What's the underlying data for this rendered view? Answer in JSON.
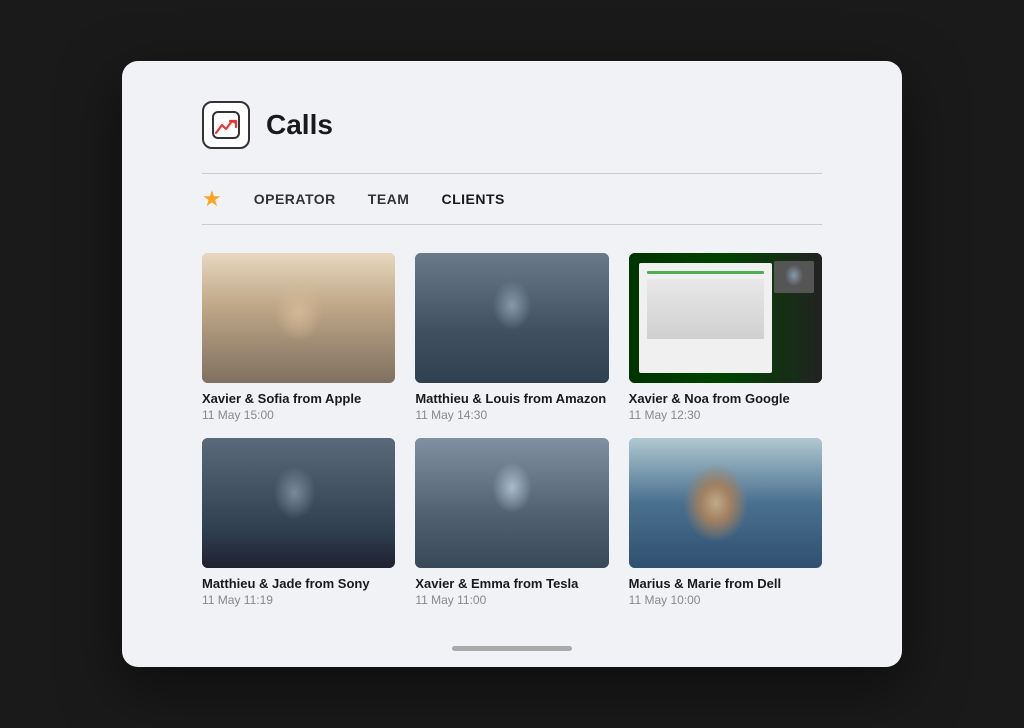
{
  "app": {
    "icon": "📉",
    "title": "Calls"
  },
  "tabs": [
    {
      "id": "operator",
      "label": "OPERATOR",
      "active": false
    },
    {
      "id": "team",
      "label": "TEAM",
      "active": false
    },
    {
      "id": "clients",
      "label": "CLIENTS",
      "active": true
    }
  ],
  "calls": [
    {
      "id": 1,
      "name": "Xavier & Sofia from Apple",
      "date": "11 May 15:00",
      "thumb": "thumb-1"
    },
    {
      "id": 2,
      "name": "Matthieu & Louis from Amazon",
      "date": "11 May 14:30",
      "thumb": "thumb-2"
    },
    {
      "id": 3,
      "name": "Xavier & Noa from Google",
      "date": "11 May 12:30",
      "thumb": "thumb-3"
    },
    {
      "id": 4,
      "name": "Matthieu & Jade from Sony",
      "date": "11 May 11:19",
      "thumb": "thumb-4"
    },
    {
      "id": 5,
      "name": "Xavier & Emma from Tesla",
      "date": "11 May 11:00",
      "thumb": "thumb-5"
    },
    {
      "id": 6,
      "name": "Marius & Marie from Dell",
      "date": "11 May 10:00",
      "thumb": "thumb-6"
    }
  ]
}
